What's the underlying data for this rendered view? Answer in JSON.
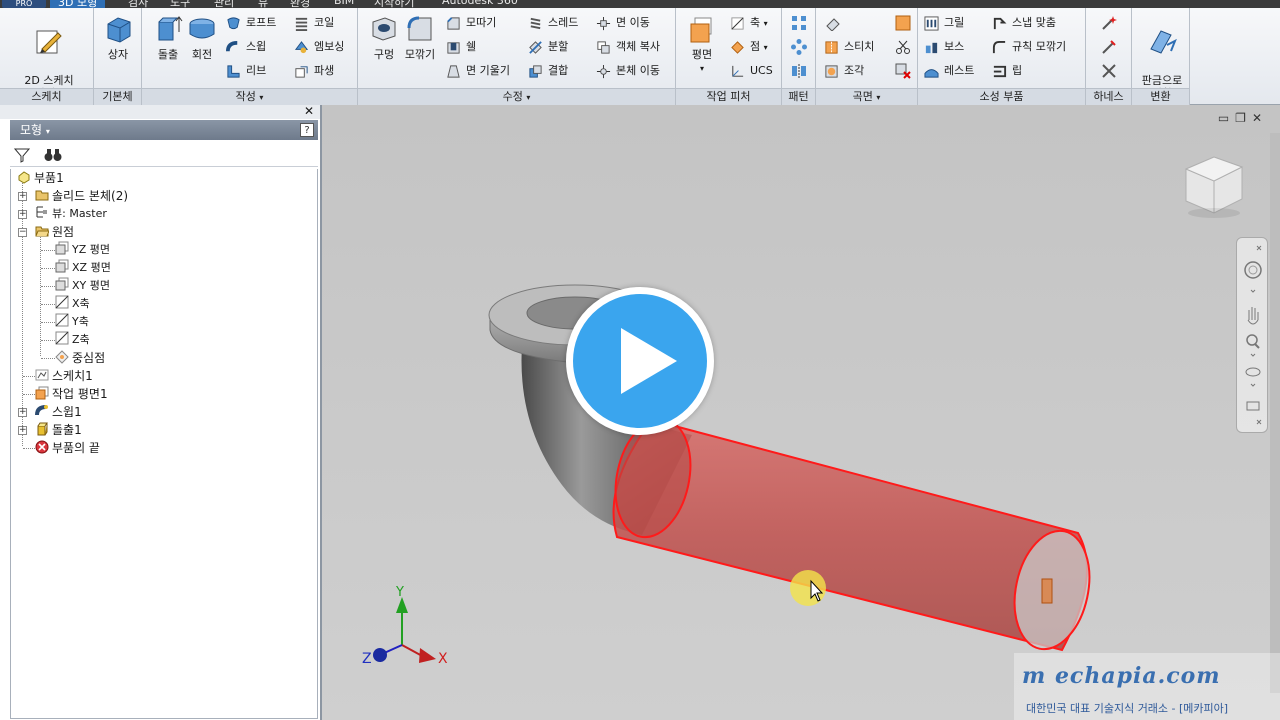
{
  "tabs": {
    "pro_badge": "PRO",
    "items": [
      {
        "label": "3D 모형",
        "active": true
      },
      {
        "label": "검사"
      },
      {
        "label": "도구"
      },
      {
        "label": "관리"
      },
      {
        "label": "뷰"
      },
      {
        "label": "환경"
      },
      {
        "label": "BIM"
      },
      {
        "label": "시작하기"
      },
      {
        "label": "Autodesk 360"
      }
    ]
  },
  "ribbon": {
    "sketch": {
      "panel": "스케치",
      "btn": "2D 스케치\n작성"
    },
    "primitive": {
      "panel": "기본체",
      "btn": "상자"
    },
    "create": {
      "panel": "작성",
      "extrude": "돌출",
      "revolve": "회전",
      "loft": "로프트",
      "sweep": "스윕",
      "rib": "리브",
      "coil": "코일",
      "emboss": "엠보싱",
      "derive": "파생"
    },
    "modify": {
      "panel": "수정",
      "hole": "구멍",
      "fillet": "모깎기",
      "chamfer": "모따기",
      "shell": "쉘",
      "draft": "면 기울기",
      "thread": "스레드",
      "split": "분할",
      "combine": "결합",
      "move_face": "면 이동",
      "copy_object": "객체 복사",
      "move_body": "본체 이동"
    },
    "work": {
      "panel": "작업 피처",
      "plane": "평면",
      "axis": "축",
      "point": "점",
      "ucs": "UCS"
    },
    "pattern": {
      "panel": "패턴"
    },
    "surface": {
      "panel": "곡면",
      "stitch": "스티치",
      "sculpt": "조각"
    },
    "plastic": {
      "panel": "소성 부품",
      "grill": "그릴",
      "boss": "보스",
      "rest": "레스트",
      "snap_fit": "스냅 맞춤",
      "rule_fillet": "규칙 모깎기",
      "lip": "립"
    },
    "harness": {
      "panel": "하네스"
    },
    "convert": {
      "panel": "변환",
      "btn": "판금으로\n변환"
    }
  },
  "browser": {
    "title": "모형",
    "help": "?",
    "tree": [
      {
        "label": "부품1"
      },
      {
        "label": "솔리드 본체(2)"
      },
      {
        "label": "뷰: Master"
      },
      {
        "label": "원점"
      },
      {
        "label": "YZ 평면"
      },
      {
        "label": "XZ 평면"
      },
      {
        "label": "XY 평면"
      },
      {
        "label": "X축"
      },
      {
        "label": "Y축"
      },
      {
        "label": "Z축"
      },
      {
        "label": "중심점"
      },
      {
        "label": "스케치1"
      },
      {
        "label": "작업 평면1"
      },
      {
        "label": "스윕1"
      },
      {
        "label": "돌출1"
      },
      {
        "label": "부품의 끝"
      }
    ]
  },
  "viewport": {
    "axis_x": "X",
    "axis_y": "Y",
    "axis_z": "Z",
    "watermark_logo": "m echapia.com",
    "watermark_sub": "대한민국 대표 기술지식 거래소 - [메카피아]"
  },
  "colors": {
    "ribbon_bg": "#eef1f5",
    "tab_active": "#2f6fb5",
    "pipe_red": "#c0504d",
    "pipe_edge": "#ff0000",
    "play_blue": "#3aa5ee"
  }
}
